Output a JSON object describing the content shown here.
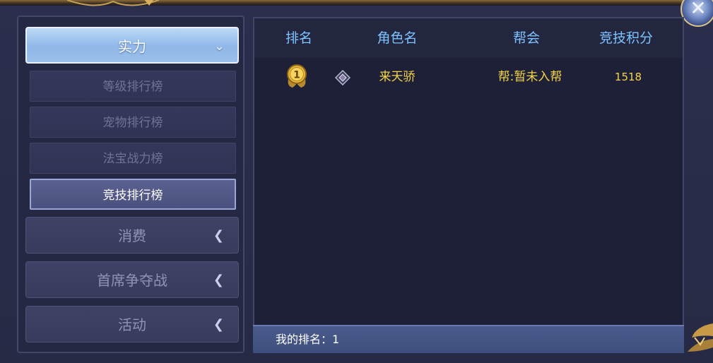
{
  "window": {
    "close_icon": "close-icon"
  },
  "sidebar": {
    "categories": [
      {
        "label": "实力",
        "arrow": "chevron-down-icon",
        "active": true
      },
      {
        "label": "消费",
        "arrow": "chevron-left-icon",
        "active": false
      },
      {
        "label": "首席争夺战",
        "arrow": "chevron-left-icon",
        "active": false
      },
      {
        "label": "活动",
        "arrow": "chevron-left-icon",
        "active": false
      }
    ],
    "sub_items": [
      {
        "label": "等级排行榜",
        "selected": false
      },
      {
        "label": "宠物排行榜",
        "selected": false
      },
      {
        "label": "法宝战力榜",
        "selected": false
      },
      {
        "label": "竞技排行榜",
        "selected": true
      }
    ],
    "arrow_down_glyph": "⌄",
    "arrow_left_glyph": "❮"
  },
  "table": {
    "headers": {
      "rank": "排名",
      "name": "角色名",
      "guild": "帮会",
      "score": "竞技积分"
    },
    "rows": [
      {
        "rank": "1",
        "rank_icon": "gold-medal-icon",
        "job_icon": "class-emblem-icon",
        "name": "来天骄",
        "guild": "帮:暂未入帮",
        "score": "1518"
      }
    ]
  },
  "footer": {
    "my_rank_label": "我的排名：",
    "my_rank_value": "1"
  },
  "colors": {
    "header_text": "#7ec3ff",
    "row_text": "#f5d448",
    "panel_bg": "#1d2036",
    "active_category": "#9cc0ea",
    "footer_bg": "#44558a"
  }
}
